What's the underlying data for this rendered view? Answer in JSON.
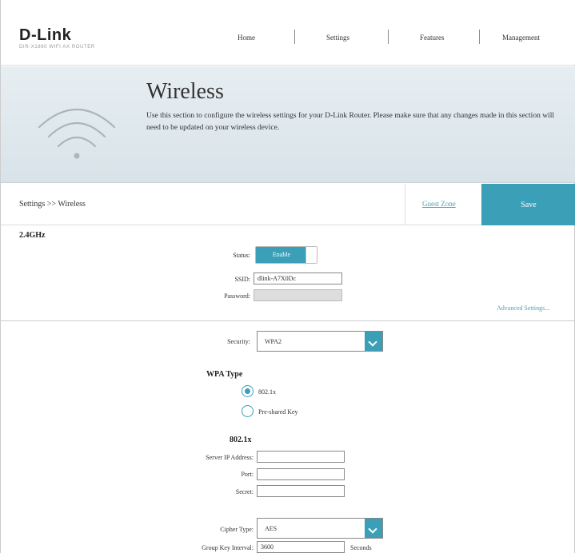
{
  "brand": {
    "logo": "D-Link",
    "tagline": "DIR-X1860 WIFI AX ROUTER"
  },
  "nav": {
    "items": [
      "Home",
      "Settings",
      "Features",
      "Management"
    ]
  },
  "hero": {
    "title": "Wireless",
    "description": "Use this section to configure the wireless settings for your D-Link Router. Please make sure that any changes made in this section will need to be updated on your wireless device.",
    "icon": "wifi-icon"
  },
  "breadcrumb": {
    "text": "Settings >> Wireless"
  },
  "actions": {
    "quick_zone": "Guest Zone",
    "save": "Save"
  },
  "band": {
    "title": "2.4GHz",
    "status_label": "Status:",
    "status_value": "Enable",
    "ssid_label": "SSID:",
    "ssid_value": "dlink-A7X0Dc",
    "password_label": "Password:",
    "password_value": "",
    "advanced_link": "Advanced Settings..."
  },
  "security": {
    "label": "Security:",
    "value": "WPA2",
    "wpa_type_title": "WPA Type",
    "wpa_options": [
      {
        "label": "802.1x",
        "selected": true
      },
      {
        "label": "Pre-shared Key",
        "selected": false
      }
    ]
  },
  "radius": {
    "title": "802.1x",
    "server_label": "Server IP Address:",
    "server_value": "",
    "port_label": "Port:",
    "port_value": "",
    "secret_label": "Secret:",
    "secret_value": ""
  },
  "cipher": {
    "label": "Cipher Type:",
    "value": "AES",
    "group_key_label": "Group Key Interval:",
    "group_key_value": "3600",
    "group_key_unit": "Seconds"
  },
  "colors": {
    "accent": "#3a9fb7",
    "hero_bg": "#dde7ec"
  }
}
